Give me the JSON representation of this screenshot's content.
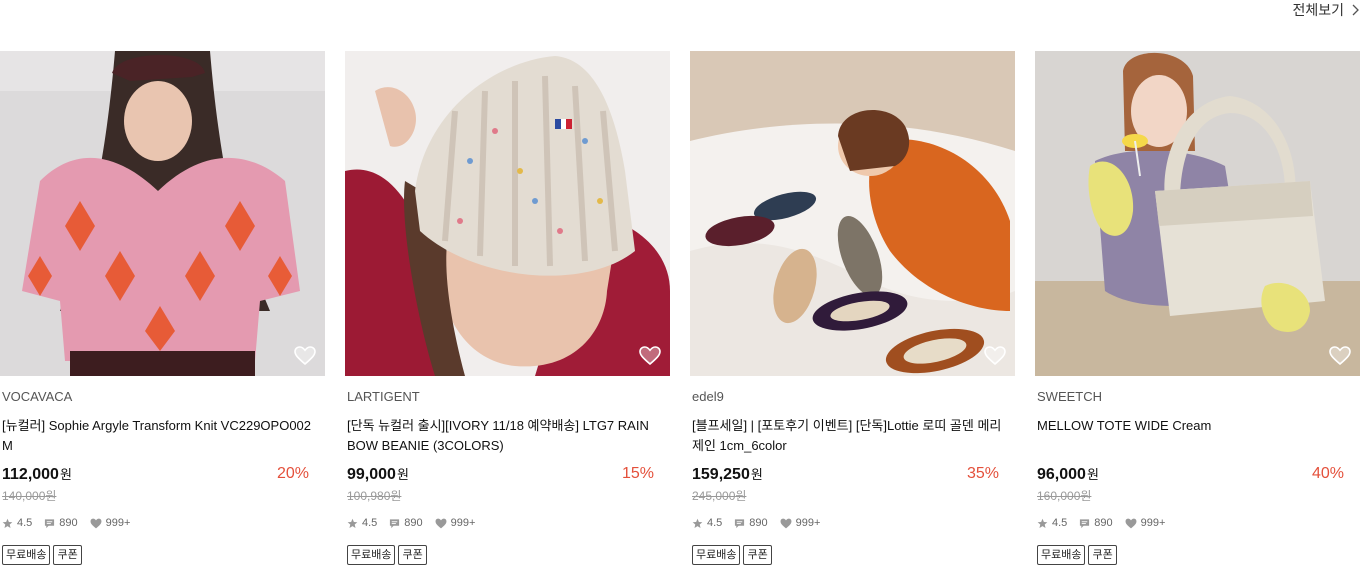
{
  "header": {
    "view_all_label": "전체보기"
  },
  "products": [
    {
      "brand": "VOCAVACA",
      "title": "[뉴컬러] Sophie Argyle Transform Knit VC229OPO002M",
      "price": "112,000",
      "currency": "원",
      "discount": "20%",
      "original_price": "140,000원",
      "rating": "4.5",
      "reviews": "890",
      "likes": "999+",
      "badges": [
        "무료배송",
        "쿠폰"
      ],
      "image_icon": "product-photo-argyle-knit"
    },
    {
      "brand": "LARTIGENT",
      "title": "[단독 뉴컬러 출시][IVORY 11/18 예약배송] LTG7 RAINBOW BEANIE (3COLORS)",
      "price": "99,000",
      "currency": "원",
      "discount": "15%",
      "original_price": "100,980원",
      "rating": "4.5",
      "reviews": "890",
      "likes": "999+",
      "badges": [
        "무료배송",
        "쿠폰"
      ],
      "image_icon": "product-photo-rainbow-beanie"
    },
    {
      "brand": "edel9",
      "title": "[블프세일] | [포토후기 이벤트] [단독]Lottie 로띠 골덴 메리제인 1cm_6color",
      "price": "159,250",
      "currency": "원",
      "discount": "35%",
      "original_price": "245,000원",
      "rating": "4.5",
      "reviews": "890",
      "likes": "999+",
      "badges": [
        "무료배송",
        "쿠폰"
      ],
      "image_icon": "product-photo-mary-jane-shoes"
    },
    {
      "brand": "SWEETCH",
      "title": "MELLOW TOTE WIDE Cream",
      "price": "96,000",
      "currency": "원",
      "discount": "40%",
      "original_price": "160,000원",
      "rating": "4.5",
      "reviews": "890",
      "likes": "999+",
      "badges": [
        "무료배송",
        "쿠폰"
      ],
      "image_icon": "product-photo-mellow-tote"
    }
  ],
  "colors": {
    "discount": "#e4503b",
    "original_price": "#999999",
    "badge_border": "#444444"
  }
}
